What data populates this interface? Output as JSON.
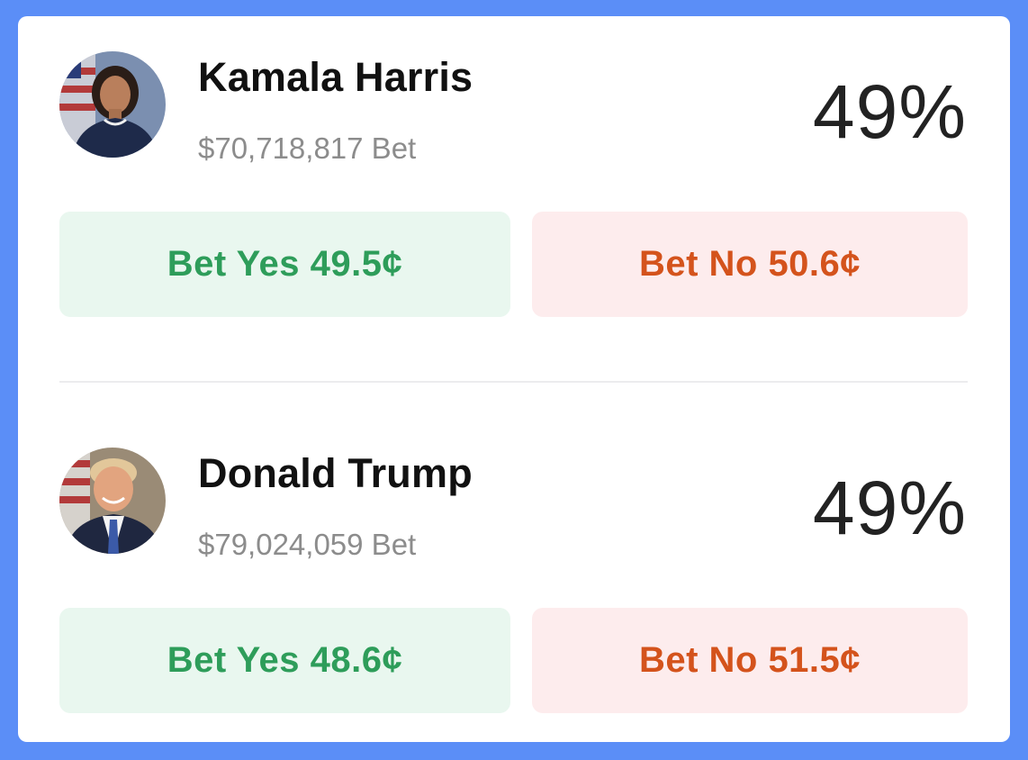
{
  "candidates": [
    {
      "name": "Kamala Harris",
      "volume": "$70,718,817 Bet",
      "percent": "49%",
      "yes_label": "Bet Yes 49.5¢",
      "no_label": "Bet No 50.6¢"
    },
    {
      "name": "Donald Trump",
      "volume": "$79,024,059 Bet",
      "percent": "49%",
      "yes_label": "Bet Yes 48.6¢",
      "no_label": "Bet No 51.5¢"
    }
  ],
  "colors": {
    "page_background": "#5b8ef7",
    "card_background": "#ffffff",
    "yes_text": "#2e9d5a",
    "yes_background": "#e9f7ef",
    "no_text": "#d4531c",
    "no_background": "#fdeced",
    "muted_text": "#8c8c8c"
  },
  "icons": {
    "avatar_harris": "candidate-photo-harris",
    "avatar_trump": "candidate-photo-trump"
  }
}
